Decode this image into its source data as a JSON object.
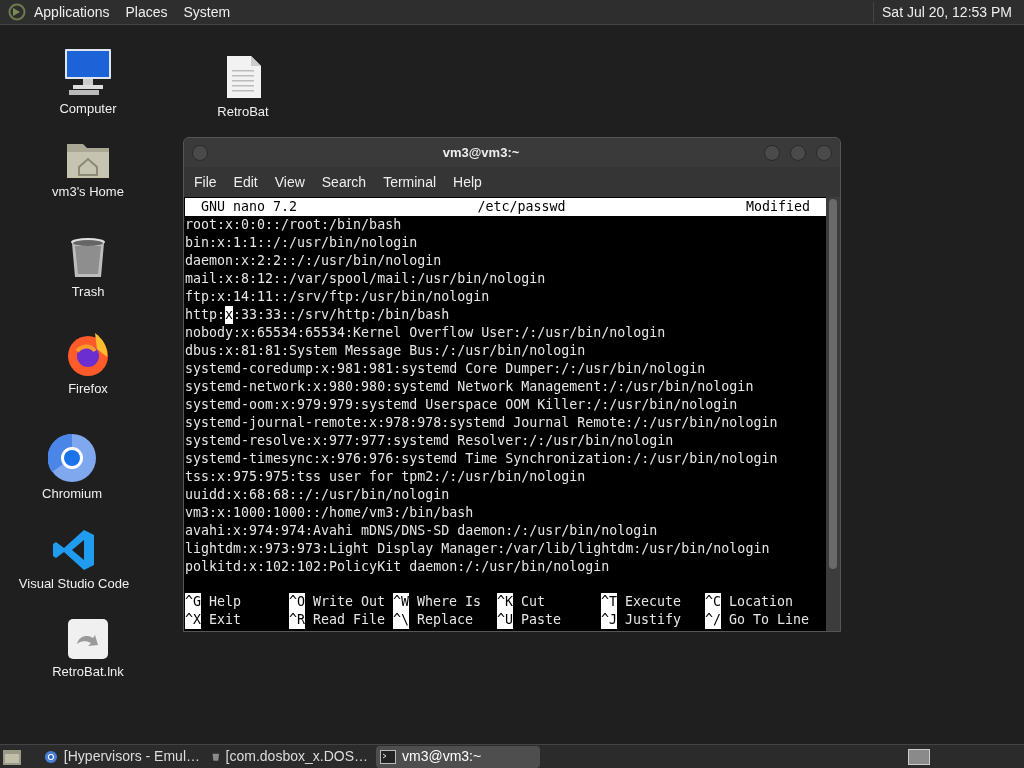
{
  "top_panel": {
    "menus": [
      "Applications",
      "Places",
      "System"
    ],
    "clock": "Sat Jul 20, 12:53 PM"
  },
  "desktop_icons": [
    {
      "kind": "computer",
      "label": "Computer"
    },
    {
      "kind": "document",
      "label": "RetroBat"
    },
    {
      "kind": "home",
      "label": "vm3's Home"
    },
    {
      "kind": "trash",
      "label": "Trash"
    },
    {
      "kind": "firefox",
      "label": "Firefox"
    },
    {
      "kind": "chromium",
      "label": "Chromium"
    },
    {
      "kind": "vscode",
      "label": "Visual Studio Code"
    },
    {
      "kind": "shortcut",
      "label": "RetroBat.lnk"
    }
  ],
  "terminal": {
    "title": "vm3@vm3:~",
    "menu": [
      "File",
      "Edit",
      "View",
      "Search",
      "Terminal",
      "Help"
    ],
    "nano": {
      "version": "GNU nano 7.2",
      "file": "/etc/passwd",
      "status": "Modified",
      "lines": [
        {
          "text": "root:x:0:0::/root:/bin/bash"
        },
        {
          "text": "bin:x:1:1::/:/usr/bin/nologin"
        },
        {
          "text": "daemon:x:2:2::/:/usr/bin/nologin"
        },
        {
          "text": "mail:x:8:12::/var/spool/mail:/usr/bin/nologin"
        },
        {
          "text": "ftp:x:14:11::/srv/ftp:/usr/bin/nologin"
        },
        {
          "text": "http:",
          "cursor": "x",
          "rest": ":33:33::/srv/http:/bin/bash"
        },
        {
          "text": "nobody:x:65534:65534:Kernel Overflow User:/:/usr/bin/nologin"
        },
        {
          "text": "dbus:x:81:81:System Message Bus:/:/usr/bin/nologin"
        },
        {
          "text": "systemd-coredump:x:981:981:systemd Core Dumper:/:/usr/bin/nologin"
        },
        {
          "text": "systemd-network:x:980:980:systemd Network Management:/:/usr/bin/nologin"
        },
        {
          "text": "systemd-oom:x:979:979:systemd Userspace OOM Killer:/:/usr/bin/nologin"
        },
        {
          "text": "systemd-journal-remote:x:978:978:systemd Journal Remote:/:/usr/bin/nologin"
        },
        {
          "text": "systemd-resolve:x:977:977:systemd Resolver:/:/usr/bin/nologin"
        },
        {
          "text": "systemd-timesync:x:976:976:systemd Time Synchronization:/:/usr/bin/nologin"
        },
        {
          "text": "tss:x:975:975:tss user for tpm2:/:/usr/bin/nologin"
        },
        {
          "text": "uuidd:x:68:68::/:/usr/bin/nologin"
        },
        {
          "text": "vm3:x:1000:1000::/home/vm3:/bin/bash"
        },
        {
          "text": "avahi:x:974:974:Avahi mDNS/DNS-SD daemon:/:/usr/bin/nologin"
        },
        {
          "text": "lightdm:x:973:973:Light Display Manager:/var/lib/lightdm:/usr/bin/nologin"
        },
        {
          "text": "polkitd:x:102:102:PolicyKit daemon:/:/usr/bin/nologin"
        }
      ],
      "shortcuts": [
        {
          "key": "^G",
          "label": "Help"
        },
        {
          "key": "^O",
          "label": "Write Out"
        },
        {
          "key": "^W",
          "label": "Where Is"
        },
        {
          "key": "^K",
          "label": "Cut"
        },
        {
          "key": "^T",
          "label": "Execute"
        },
        {
          "key": "^C",
          "label": "Location"
        },
        {
          "key": "^X",
          "label": "Exit"
        },
        {
          "key": "^R",
          "label": "Read File"
        },
        {
          "key": "^\\",
          "label": "Replace"
        },
        {
          "key": "^U",
          "label": "Paste"
        },
        {
          "key": "^J",
          "label": "Justify"
        },
        {
          "key": "^/",
          "label": "Go To Line"
        }
      ]
    }
  },
  "taskbar": {
    "tasks": [
      {
        "kind": "browser",
        "title": "[Hypervisors - Emul…",
        "selected": false
      },
      {
        "kind": "trash",
        "title": "[com.dosbox_x.DOS…",
        "selected": false
      },
      {
        "kind": "terminal",
        "title": "vm3@vm3:~",
        "selected": true
      }
    ]
  }
}
